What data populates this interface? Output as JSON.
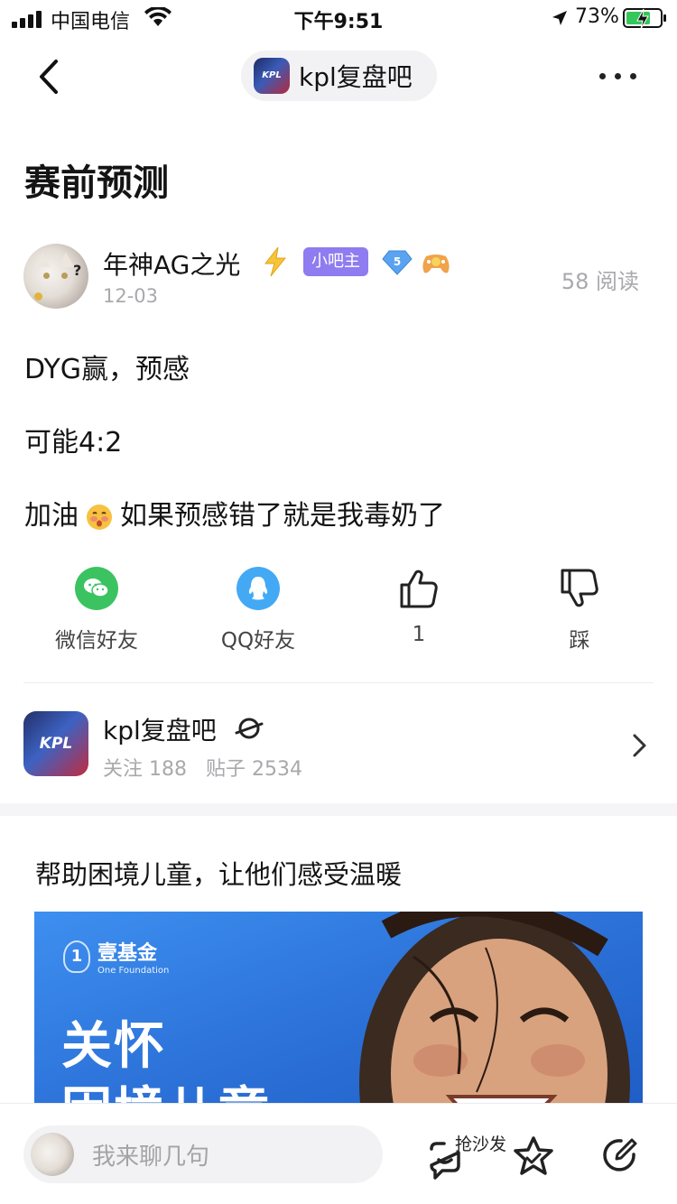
{
  "status_bar": {
    "carrier": "中国电信",
    "time": "下午9:51",
    "battery_percent": "73%",
    "battery_level": 0.73,
    "icons": [
      "signal-icon",
      "wifi-icon",
      "location-arrow-icon",
      "battery-charging-icon"
    ]
  },
  "nav": {
    "bar_name": "kpl复盘吧",
    "logo_text": "KPL",
    "icons": [
      "back-chevron-icon",
      "more-dots-icon"
    ]
  },
  "post": {
    "title": "赛前预测",
    "author": {
      "name": "年神AG之光",
      "badge": "小吧主",
      "level": "5",
      "date": "12-03",
      "reads": "58 阅读"
    },
    "lines": [
      {
        "text": "DYG赢，预感"
      },
      {
        "text": "可能4:2"
      },
      {
        "before": "加油",
        "emoji": "hot-face-emoji",
        "after": "如果预感错了就是我毒奶了"
      }
    ]
  },
  "actions": {
    "wechat": "微信好友",
    "qq": "QQ好友",
    "like_count": "1",
    "dislike": "踩"
  },
  "forum": {
    "name": "kpl复盘吧",
    "logo_text": "KPL",
    "follow": "关注 188",
    "posts": "贴子 2534"
  },
  "ad": {
    "title": "帮助困境儿童，让他们感受温暖",
    "brand_cn": "壹基金",
    "brand_en": "One Foundation",
    "brand_mark": "1",
    "headline1": "关怀",
    "headline2": "困境儿童"
  },
  "bottom": {
    "reply_placeholder": "我来聊几句",
    "sofa_label": "抢沙发"
  },
  "colors": {
    "badge_purple": "#8e7cf0",
    "wechat_green": "#3cc361",
    "qq_blue": "#44a9f5",
    "ad_blue": "#2d73d9"
  }
}
